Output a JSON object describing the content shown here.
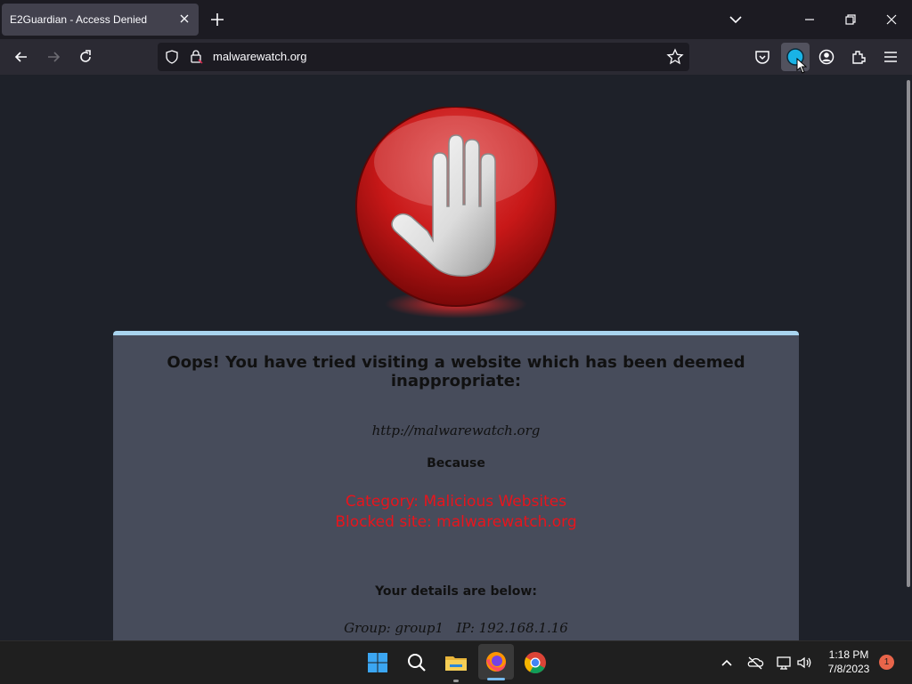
{
  "browser": {
    "tab": {
      "title": "E2Guardian - Access Denied"
    },
    "url": "malwarewatch.org"
  },
  "icons": [
    "close-icon",
    "plus-icon",
    "chevron-down-icon",
    "minimize-icon",
    "restore-icon",
    "window-close-icon",
    "back-icon",
    "forward-icon",
    "reload-icon",
    "shield-icon",
    "lock-icon",
    "star-icon",
    "pocket-icon",
    "extension-active-icon",
    "account-icon",
    "extensions-icon",
    "menu-icon",
    "stop-hand-icon",
    "windows-start-icon",
    "search-icon",
    "file-explorer-icon",
    "firefox-icon",
    "chrome-icon",
    "chevron-up-icon",
    "onedrive-offline-icon",
    "network-icon",
    "volume-icon"
  ],
  "page": {
    "heading": "Oops! You have tried visiting a website which has been deemed inappropriate:",
    "blocked_url": "http://malwarewatch.org",
    "because": "Because",
    "category": "Category: Malicious Websites",
    "blocked_site": "Blocked site: malwarewatch.org",
    "details_heading": "Your details are below:",
    "group_line": "Group: group1   IP: 192.168.1.16"
  },
  "colors": {
    "accent": "#a9d4ef",
    "reason": "#e8141c",
    "panel": "#474c5b",
    "background": "#1e2129"
  },
  "taskbar": {
    "time": "1:18 PM",
    "date": "7/8/2023",
    "notification_count": "1"
  }
}
